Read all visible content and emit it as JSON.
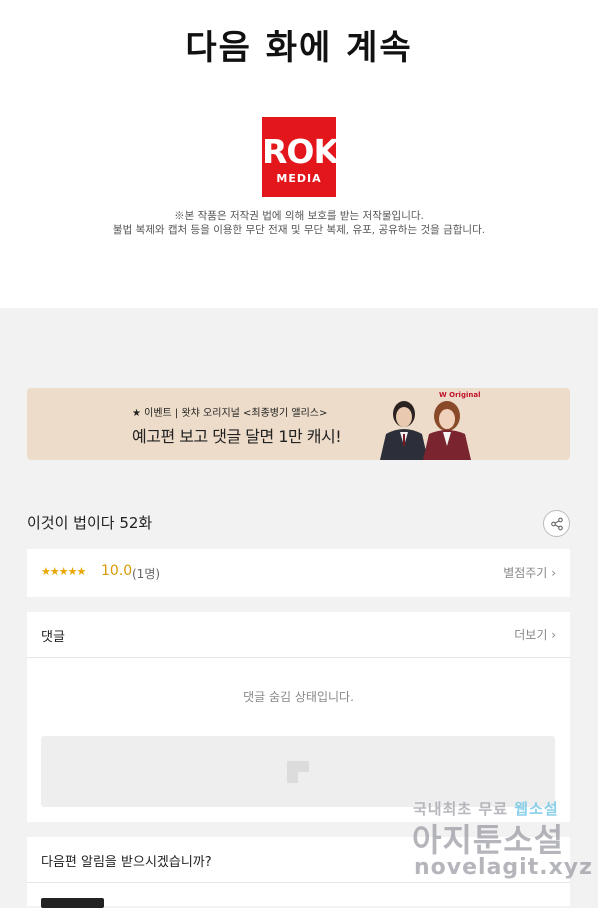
{
  "top": {
    "next_title": "다음 화에 계속",
    "logo_line1": "ROK",
    "logo_line2": "MEDIA",
    "copyright_line1": "※본 작품은 저작권 법에 의해 보호를 받는 저작물입니다.",
    "copyright_line2": "불법 복제와 캡처 등을 이용한 무단 전재 및 무단 복제, 유포, 공유하는 것을 금합니다."
  },
  "banner": {
    "small_text": "★ 이벤트 | 왓챠 오리지널 <최종병기 앨리스>",
    "big_text": "예고편 보고 댓글 달면 1만 캐시!",
    "brand_mark": "W Original"
  },
  "episode": {
    "title": "이것이 법이다 52화"
  },
  "rating": {
    "stars": "★★★★★",
    "score": "10.0",
    "count": "(1명)",
    "rate_label": "별점주기",
    "chevron": "›"
  },
  "comments": {
    "header": "댓글",
    "more_label": "더보기",
    "chevron": "›",
    "hidden_message": "댓글 숨김 상태입니다."
  },
  "notify": {
    "header": "다음편 알림을 받으시겠습니까?"
  },
  "watermark": {
    "line1_prefix": "국내최초 무료",
    "line1_highlight": "웹소설",
    "line2": "아지툰소설",
    "line3": "novelagit.xyz"
  },
  "colors": {
    "logo_red": "#e3161c",
    "star_gold": "#e8a600",
    "banner_bg": "#eddcc9"
  }
}
